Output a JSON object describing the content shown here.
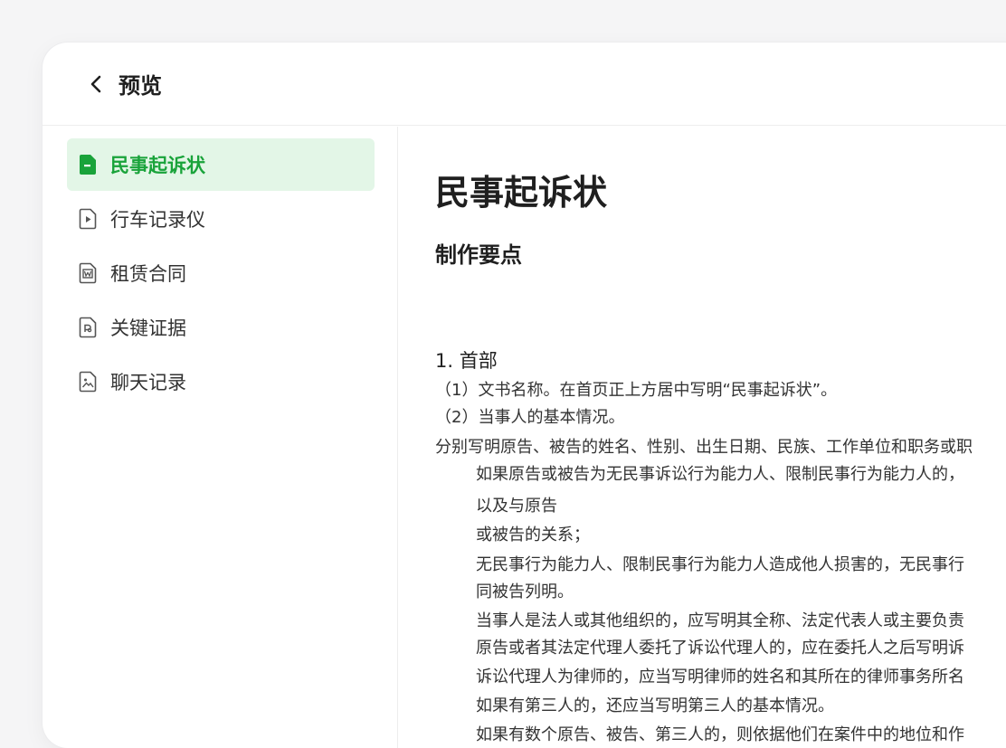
{
  "header": {
    "title": "预览"
  },
  "sidebar": {
    "items": [
      {
        "label": "民事起诉状",
        "icon": "document-icon",
        "active": true
      },
      {
        "label": "行车记录仪",
        "icon": "video-file-icon",
        "active": false
      },
      {
        "label": "租赁合同",
        "icon": "word-file-icon",
        "active": false
      },
      {
        "label": "关键证据",
        "icon": "pdf-file-icon",
        "active": false
      },
      {
        "label": "聊天记录",
        "icon": "image-file-icon",
        "active": false
      }
    ]
  },
  "document": {
    "title": "民事起诉状",
    "section": "制作要点",
    "lines": [
      "1. 首部",
      "（1）文书名称。在首页正上方居中写明“民事起诉状”。",
      "（2）当事人的基本情况。",
      "分别写明原告、被告的姓名、性别、出生日期、民族、工作单位和职务或职",
      "如果原告或被告为无民事诉讼行为能力人、限制民事行为能力人的，",
      "以及与原告",
      "或被告的关系；",
      "无民事行为能力人、限制民事行为能力人造成他人损害的，无民事行",
      "同被告列明。",
      "当事人是法人或其他组织的，应写明其全称、法定代表人或主要负责",
      "原告或者其法定代理人委托了诉讼代理人的，应在委托人之后写明诉",
      "诉讼代理人为律师的，应当写明律师的姓名和其所在的律师事务所名",
      "如果有第三人的，还应当写明第三人的基本情况。",
      "如果有数个原告、被告、第三人的，则依据他们在案件中的地位和作"
    ]
  },
  "colors": {
    "accent": "#19a33a",
    "active_bg": "#e3f6e7"
  }
}
